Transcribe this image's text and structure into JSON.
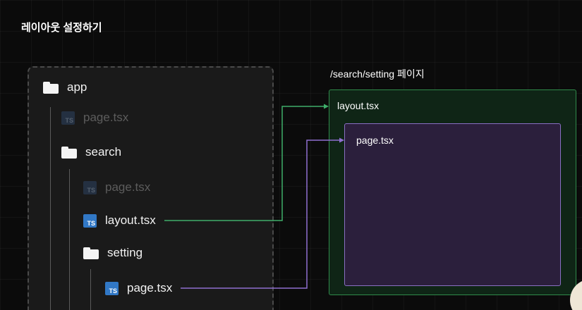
{
  "title": "레이아웃 설정하기",
  "tree": {
    "app": "app",
    "app_page": "page.tsx",
    "search": "search",
    "search_page": "page.tsx",
    "search_layout": "layout.tsx",
    "setting": "setting",
    "setting_page": "page.tsx",
    "ts_badge": "TS"
  },
  "preview": {
    "caption": "/search/setting 페이지",
    "layout_label": "layout.tsx",
    "page_label": "page.tsx"
  },
  "colors": {
    "layout_link": "#3fae6a",
    "page_link": "#8f6fd0",
    "ts_blue": "#3178c6"
  },
  "icons": [
    "folder-icon",
    "typescript-file-icon"
  ]
}
